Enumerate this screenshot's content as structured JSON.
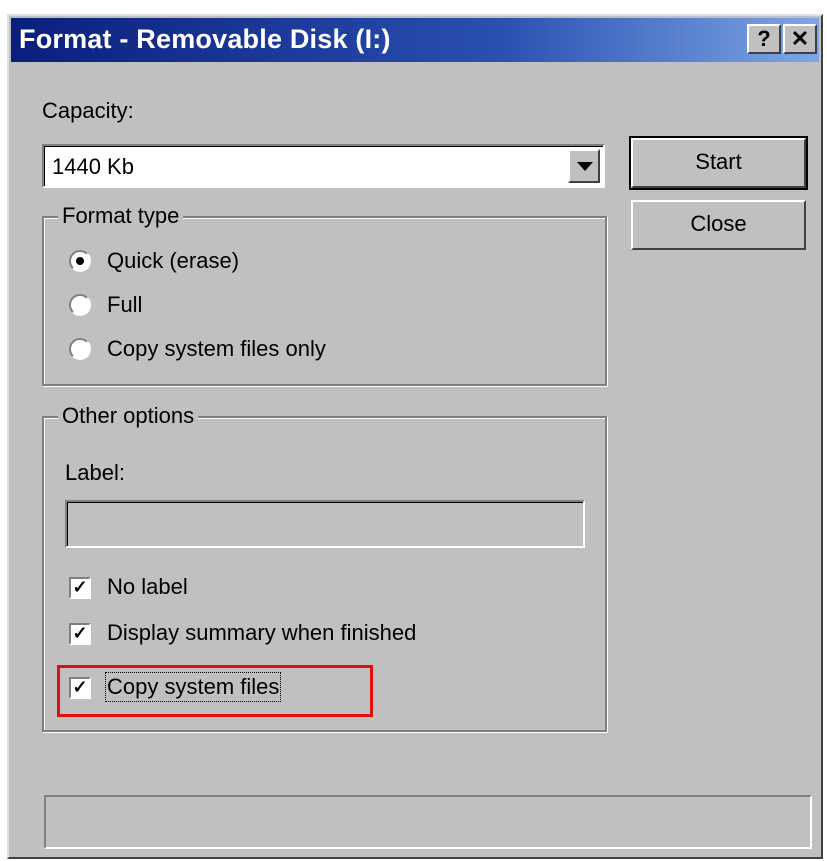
{
  "window": {
    "title": "Format - Removable Disk (I:)",
    "help_glyph": "?",
    "close_glyph": "✕"
  },
  "capacity": {
    "label": "Capacity:",
    "label_accesskey": "p",
    "selected": "1440 Kb"
  },
  "buttons": {
    "start": "Start",
    "close": "Close"
  },
  "format_type": {
    "legend": "Format type",
    "options": [
      {
        "label": "Quick (erase)",
        "selected": true
      },
      {
        "label": "Full",
        "selected": false
      },
      {
        "label": "Copy system files only",
        "selected": false
      }
    ]
  },
  "other_options": {
    "legend": "Other options",
    "label_caption": "Label:",
    "label_value": "",
    "checkboxes": [
      {
        "label": "No label",
        "checked": true
      },
      {
        "label": "Display summary when finished",
        "checked": true
      },
      {
        "label": "Copy system files",
        "checked": true
      }
    ]
  },
  "colors": {
    "title_bar_start": "#0a1f7c",
    "dialog_face": "#c0c0c0",
    "highlight_box": "#e01010"
  }
}
